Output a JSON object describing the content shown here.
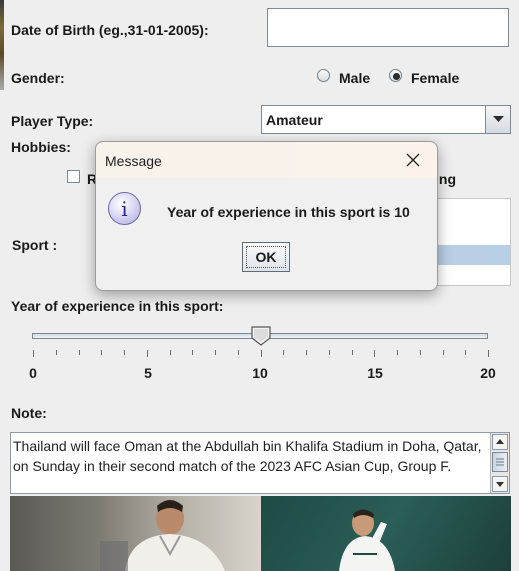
{
  "form": {
    "dob_label": "Date of Birth (eg.,31-01-2005):",
    "dob_value": "",
    "gender_label": "Gender:",
    "gender_male": "Male",
    "gender_female": "Female",
    "gender_selected": "Female",
    "player_type_label": "Player Type:",
    "player_type_value": "Amateur",
    "hobbies_label": "Hobbies:",
    "hobby_left_partial": "R",
    "hobby_right_partial": "ing",
    "sport_label": "Sport :",
    "experience_label": "Year of experience in this sport:",
    "slider": {
      "min": 0,
      "max": 20,
      "value": 10,
      "tick_labels": [
        "0",
        "5",
        "10",
        "15",
        "20"
      ]
    },
    "note_label": "Note:",
    "note_text": "Thailand will face Oman at the Abdullah bin Khalifa Stadium in Doha, Qatar, on Sunday in their second match of the 2023 AFC Asian Cup, Group F."
  },
  "dialog": {
    "title": "Message",
    "message": "Year of experience in this sport is 10",
    "ok_label": "OK",
    "info_glyph": "i"
  },
  "colors": {
    "background": "#eeeeee",
    "selection": "#b8cfe5",
    "dialog_bg": "#f0f0f0"
  }
}
